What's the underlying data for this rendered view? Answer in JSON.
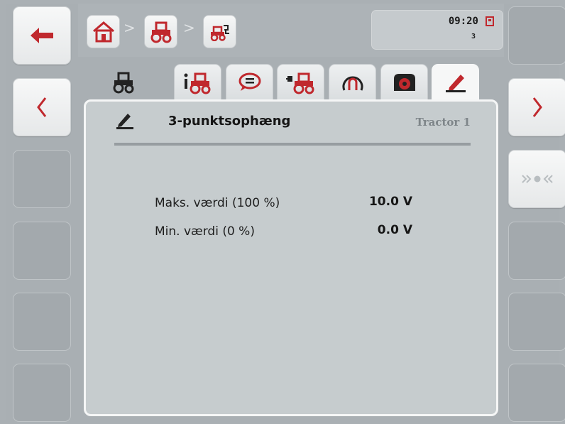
{
  "header": {
    "breadcrumb": [
      "home",
      "tractor",
      "tractor-sensor"
    ],
    "time": "09:20",
    "count": "3"
  },
  "tabs": [
    {
      "name": "tractor",
      "icon": "tractor-icon"
    },
    {
      "name": "info",
      "icon": "tractor-info-icon"
    },
    {
      "name": "messages",
      "icon": "speech-bubble-icon"
    },
    {
      "name": "connection",
      "icon": "tractor-plug-icon"
    },
    {
      "name": "speed",
      "icon": "speedometer-icon"
    },
    {
      "name": "pto",
      "icon": "pto-icon"
    },
    {
      "name": "calibration",
      "icon": "pen-icon"
    }
  ],
  "panel": {
    "title": "3-punktsophæng",
    "tractor": "Tractor 1",
    "rows": [
      {
        "label": "Maks. værdi (100 %)",
        "value": "10.0 V"
      },
      {
        "label": "Min. værdi (0 %)",
        "value": "0.0 V"
      }
    ]
  },
  "colors": {
    "accent_red": "#c0282d",
    "background": "#aab0b4",
    "panel": "#c6ccce"
  }
}
